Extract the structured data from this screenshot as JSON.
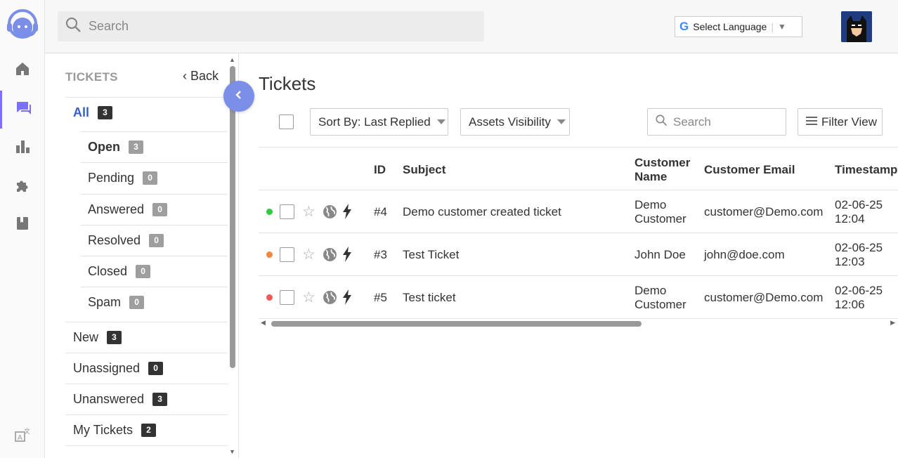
{
  "topbar": {
    "search_placeholder": "Search",
    "language_label": "Select Language",
    "google_glyph": "G"
  },
  "rail": {
    "items": [
      "home-icon",
      "tickets-icon",
      "reports-icon",
      "apps-icon",
      "knowledgebase-icon"
    ],
    "active": "tickets-icon",
    "accent": "#7c70f4"
  },
  "sidebar": {
    "heading": "TICKETS",
    "back_label": "Back",
    "all": {
      "label": "All",
      "count": "3"
    },
    "statuses": [
      {
        "label": "Open",
        "count": "3"
      },
      {
        "label": "Pending",
        "count": "0"
      },
      {
        "label": "Answered",
        "count": "0"
      },
      {
        "label": "Resolved",
        "count": "0"
      },
      {
        "label": "Closed",
        "count": "0"
      },
      {
        "label": "Spam",
        "count": "0"
      }
    ],
    "views": [
      {
        "label": "New",
        "count": "3"
      },
      {
        "label": "Unassigned",
        "count": "0"
      },
      {
        "label": "Unanswered",
        "count": "3"
      },
      {
        "label": "My Tickets",
        "count": "2"
      }
    ]
  },
  "main": {
    "title": "Tickets",
    "sort_label": "Sort By: Last Replied",
    "assets_label": "Assets Visibility",
    "search_placeholder": "Search",
    "filter_label": "Filter View",
    "columns": {
      "id": "ID",
      "subject": "Subject",
      "customer_name_1": "Customer",
      "customer_name_2": "Name",
      "customer_email": "Customer Email",
      "timestamp": "Timestamp"
    },
    "rows": [
      {
        "status_color": "#2ecc40",
        "id": "#4",
        "subject": "Demo customer created ticket",
        "name_1": "Demo",
        "name_2": "Customer",
        "email": "customer@Demo.com",
        "date": "02-06-25",
        "time": "12:04"
      },
      {
        "status_color": "#f0883e",
        "id": "#3",
        "subject": "Test Ticket",
        "name_1": "John Doe",
        "name_2": "",
        "email": "john@doe.com",
        "date": "02-06-25",
        "time": "12:03"
      },
      {
        "status_color": "#ef5a5a",
        "id": "#5",
        "subject": "Test ticket",
        "name_1": "Demo",
        "name_2": "Customer",
        "email": "customer@Demo.com",
        "date": "02-06-25",
        "time": "12:06"
      }
    ]
  }
}
